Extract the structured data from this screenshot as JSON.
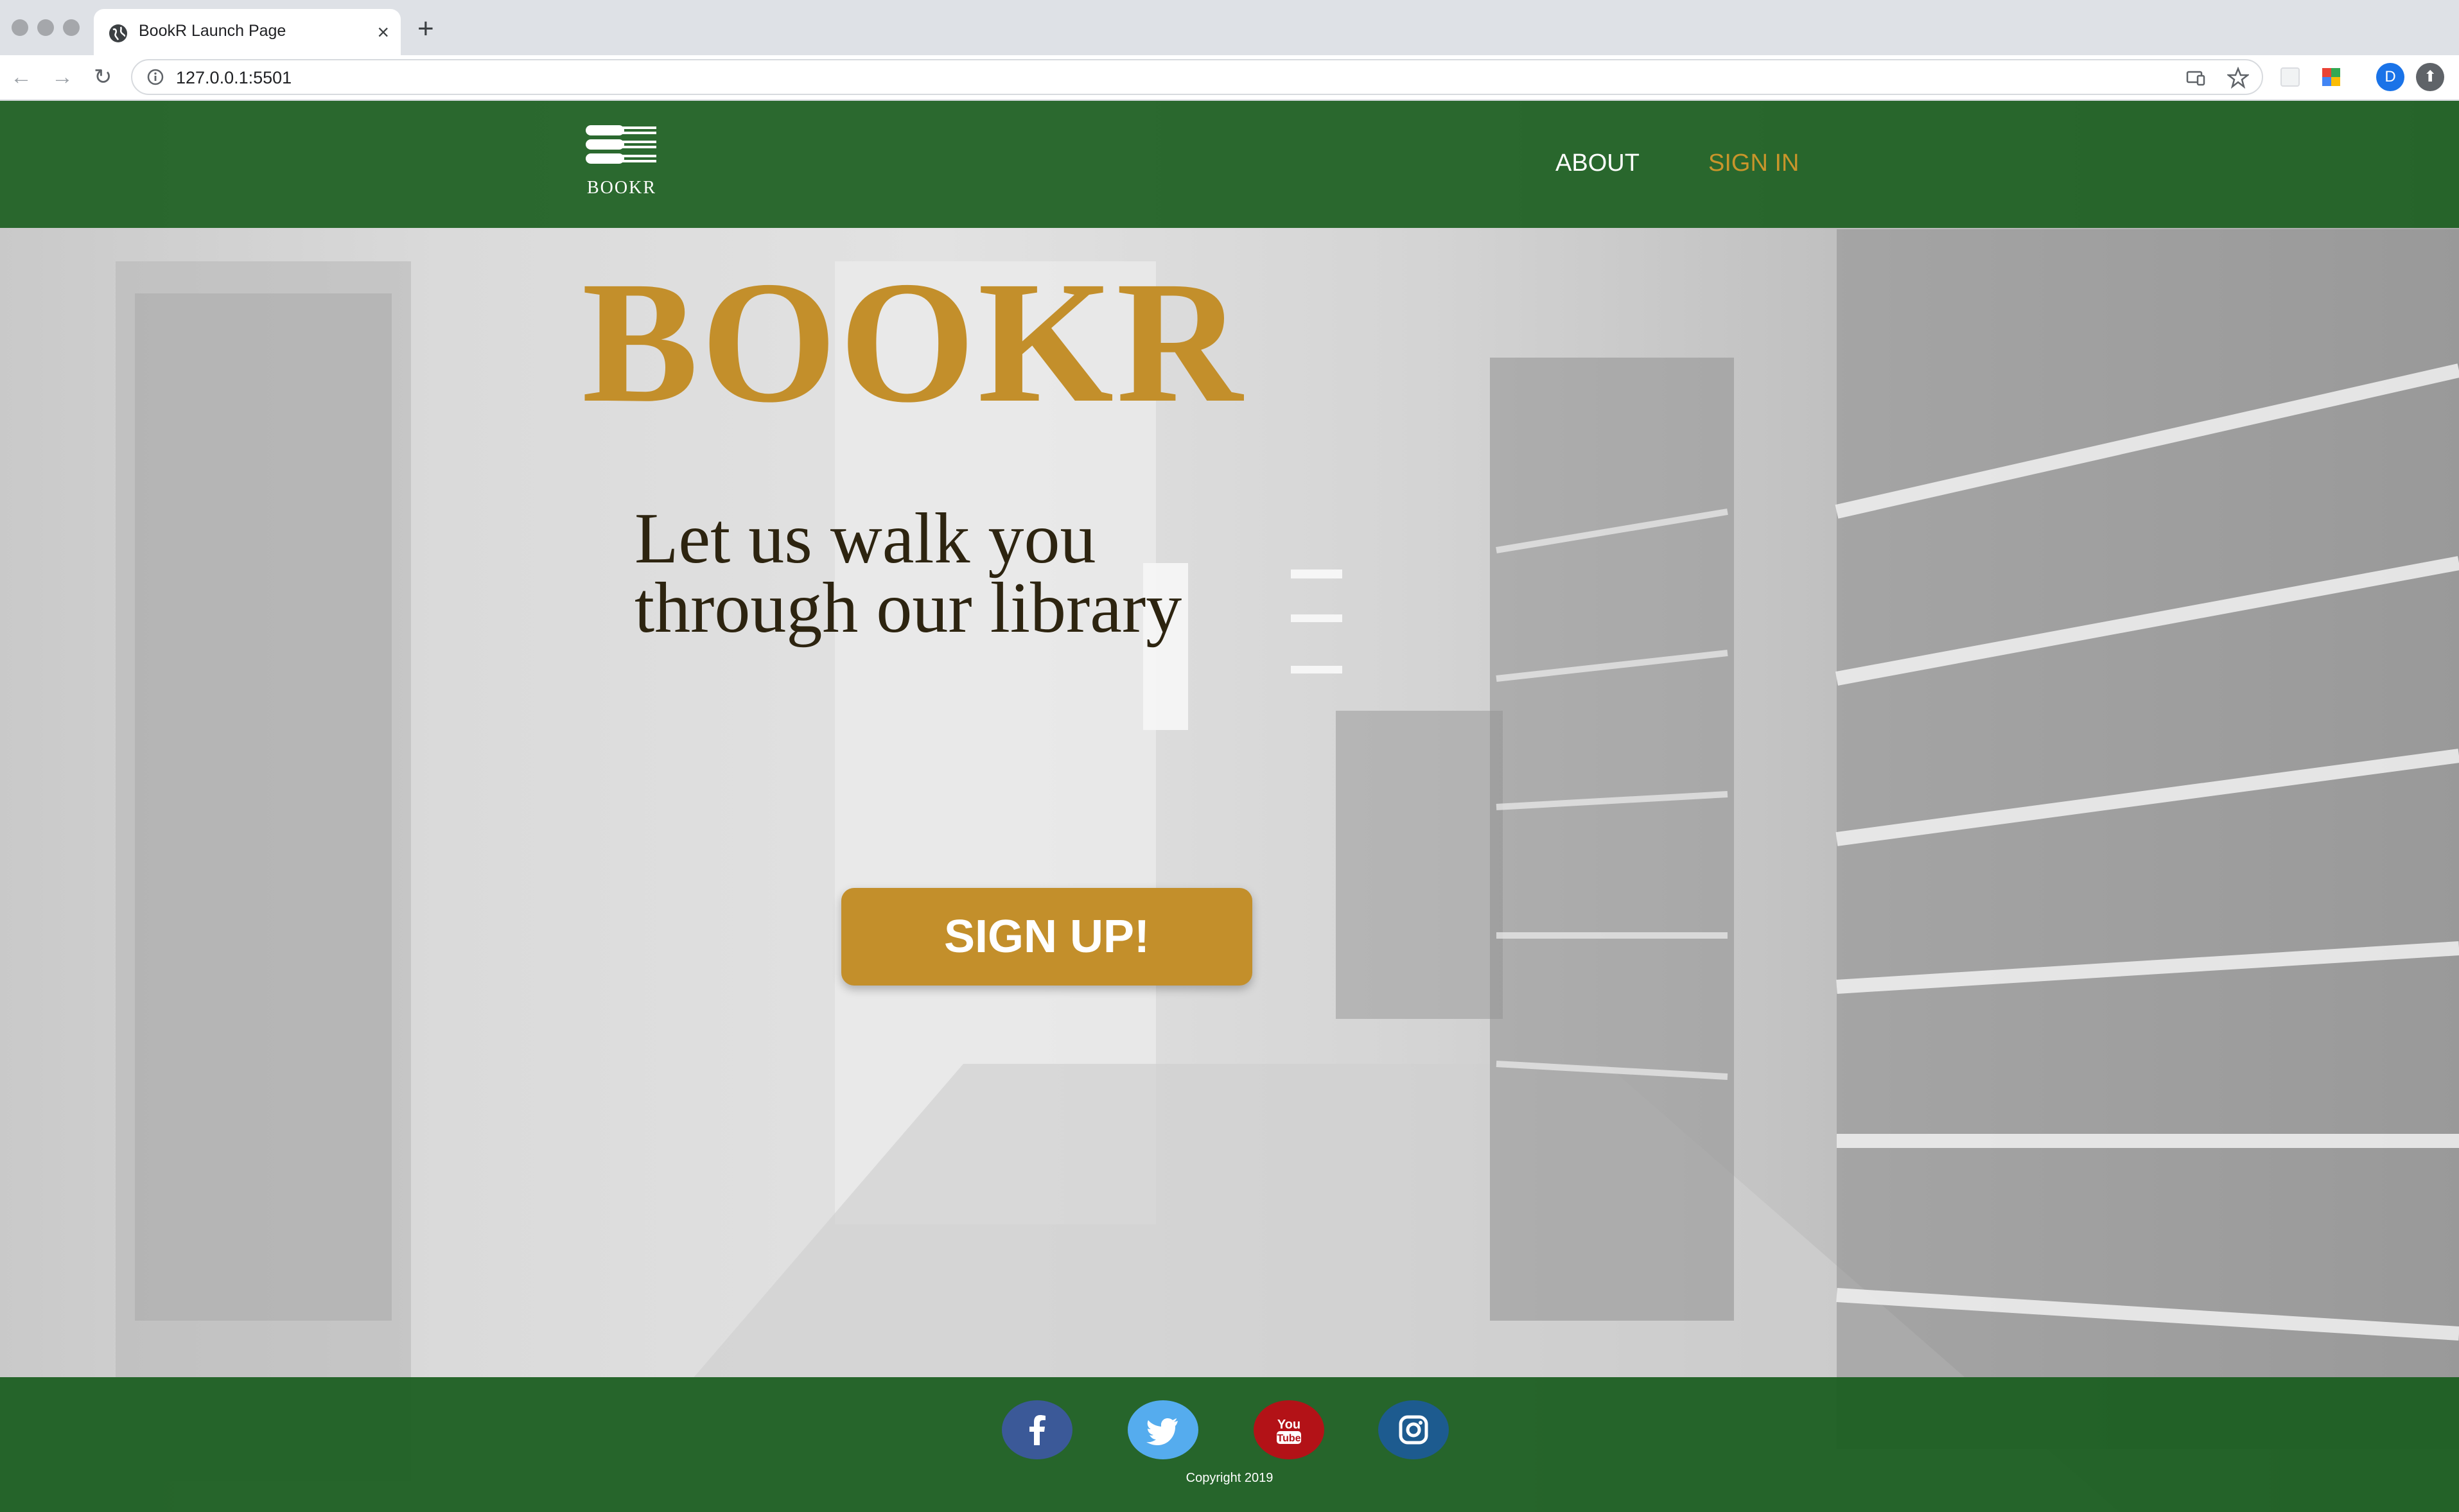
{
  "browser": {
    "tab_title": "BookR Launch Page",
    "tab_close": "×",
    "new_tab": "+",
    "back": "←",
    "forward": "→",
    "reload": "↻",
    "url": "127.0.0.1:5501",
    "profile_initial": "D"
  },
  "header": {
    "logo_text": "BOOKR",
    "nav": {
      "about": "ABOUT",
      "sign_in": "SIGN IN"
    }
  },
  "hero": {
    "title": "BOOKR",
    "tagline_line1": "Let us walk you",
    "tagline_line2": "through our library",
    "cta": "SIGN UP!"
  },
  "footer": {
    "social": [
      {
        "name": "facebook-icon",
        "color": "#3b5998"
      },
      {
        "name": "twitter-icon",
        "color": "#55acee"
      },
      {
        "name": "youtube-icon",
        "color": "#b31217"
      },
      {
        "name": "instagram-icon",
        "color": "#1d5b8f"
      }
    ],
    "youtube_text_1": "You",
    "youtube_text_2": "Tube",
    "copyright": "Copyright 2019"
  },
  "colors": {
    "header_green": "#1b5e20",
    "gold": "#c38f2b",
    "tagline": "#2d2410"
  }
}
